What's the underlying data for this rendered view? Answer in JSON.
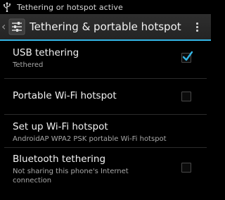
{
  "status_bar": {
    "text": "Tethering or hotspot active",
    "icon": "usb-icon"
  },
  "action_bar": {
    "title": "Tethering & portable hotspot",
    "up_icon": "chevron-left-icon",
    "app_icon": "settings-sliders-icon",
    "overflow_icon": "overflow-menu-icon",
    "accent_color": "#33b5e5"
  },
  "settings": [
    {
      "title": "USB tethering",
      "summary": "Tethered",
      "checked": true
    },
    {
      "title": "Portable Wi-Fi hotspot",
      "summary": "",
      "checked": false
    },
    {
      "title": "Set up Wi-Fi hotspot",
      "summary": "AndroidAP WPA2 PSK portable Wi-Fi hotspot"
    },
    {
      "title": "Bluetooth tethering",
      "summary_line1": "Not sharing this phone's Internet",
      "summary_line2": "connection",
      "checked": false
    }
  ]
}
